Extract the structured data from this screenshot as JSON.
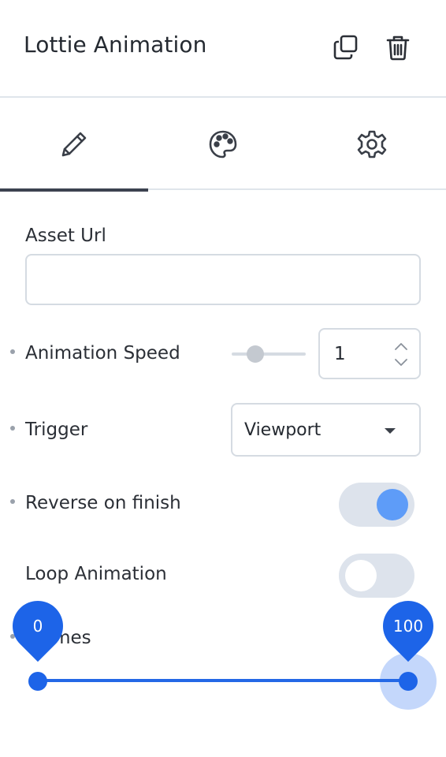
{
  "header": {
    "title": "Lottie Animation"
  },
  "tabs": [
    {
      "name": "edit",
      "icon": "pencil-icon",
      "active": true
    },
    {
      "name": "style",
      "icon": "palette-icon",
      "active": false
    },
    {
      "name": "settings",
      "icon": "gear-icon",
      "active": false
    }
  ],
  "fields": {
    "asset_url": {
      "label": "Asset Url",
      "value": ""
    },
    "animation_speed": {
      "label": "Animation Speed",
      "value": "1",
      "slider_value": 1
    },
    "trigger": {
      "label": "Trigger",
      "value": "Viewport"
    },
    "reverse_on_finish": {
      "label": "Reverse on finish",
      "on": true
    },
    "loop_animation": {
      "label": "Loop Animation",
      "on": false
    },
    "frames": {
      "label": "Frames",
      "min_value": "0",
      "max_value": "100"
    }
  },
  "colors": {
    "accent": "#1d64e8",
    "toggle_on": "#5e9cf8",
    "toggle_track": "#dde3ec",
    "border": "#d5dbe2"
  }
}
